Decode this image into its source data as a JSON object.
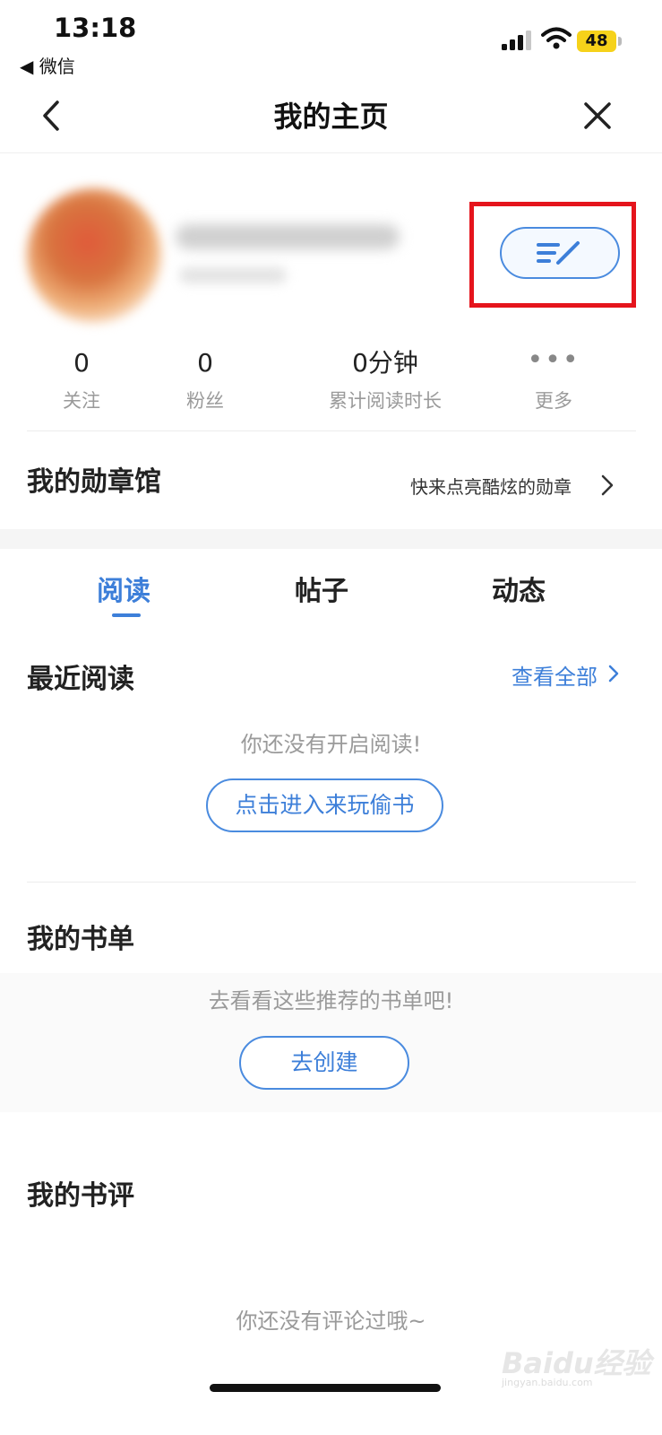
{
  "status_bar": {
    "time": "13:18",
    "back_app": "◀ 微信",
    "battery": "48"
  },
  "nav": {
    "title": "我的主页"
  },
  "stats": [
    {
      "value": "0",
      "label": "关注"
    },
    {
      "value": "0",
      "label": "粉丝"
    },
    {
      "value": "0分钟",
      "label": "累计阅读时长"
    },
    {
      "value": "•••",
      "label": "更多"
    }
  ],
  "medal": {
    "title": "我的勋章馆",
    "hint": "快来点亮酷炫的勋章"
  },
  "tabs": [
    {
      "label": "阅读",
      "active": true
    },
    {
      "label": "帖子",
      "active": false
    },
    {
      "label": "动态",
      "active": false
    }
  ],
  "recent_reading": {
    "title": "最近阅读",
    "view_all": "查看全部",
    "empty_text": "你还没有开启阅读!",
    "button": "点击进入来玩偷书"
  },
  "book_list": {
    "title": "我的书单",
    "empty_text": "去看看这些推荐的书单吧!",
    "button": "去创建"
  },
  "book_review": {
    "title": "我的书评",
    "empty_text": "你还没有评论过哦~"
  },
  "watermark": {
    "text": "Baidu经验",
    "sub": "jingyan.baidu.com"
  },
  "colors": {
    "accent": "#3d7fd9",
    "highlight": "#e5141c"
  }
}
